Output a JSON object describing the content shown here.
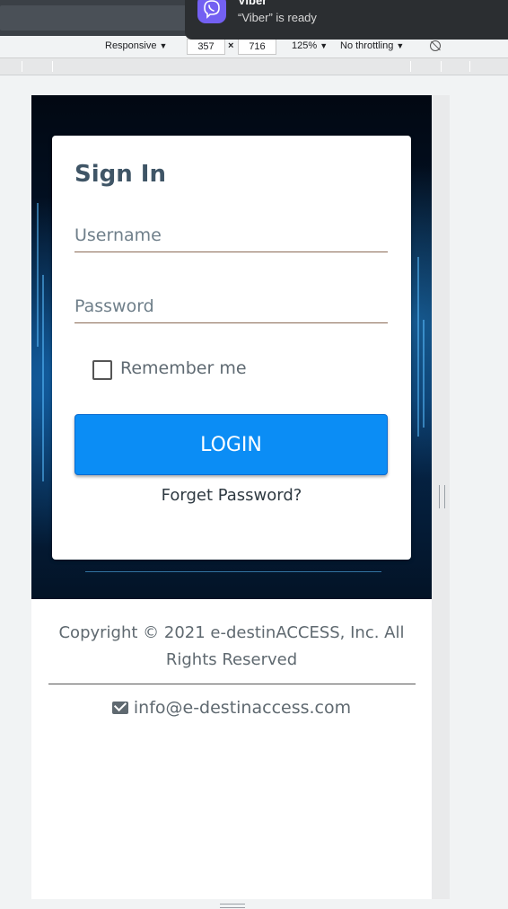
{
  "devtools": {
    "device_mode": "Responsive",
    "width": "357",
    "times": "×",
    "height": "716",
    "zoom": "125%",
    "throttling": "No throttling",
    "dropdown_arrow": "▼"
  },
  "notification": {
    "app": "Viber",
    "message": "“Viber” is ready"
  },
  "signin": {
    "title": "Sign In",
    "username_placeholder": "Username",
    "password_placeholder": "Password",
    "remember_label": "Remember me",
    "login_label": "LOGIN",
    "forgot_label": "Forget Password?"
  },
  "footer": {
    "copyright": "Copyright © 2021 e-destinACCESS, Inc. All Rights Reserved",
    "email": "info@e-destinaccess.com"
  },
  "colors": {
    "login_button": "#0b8df5",
    "title": "#3f5566",
    "input_underline": "#8a6a55"
  }
}
